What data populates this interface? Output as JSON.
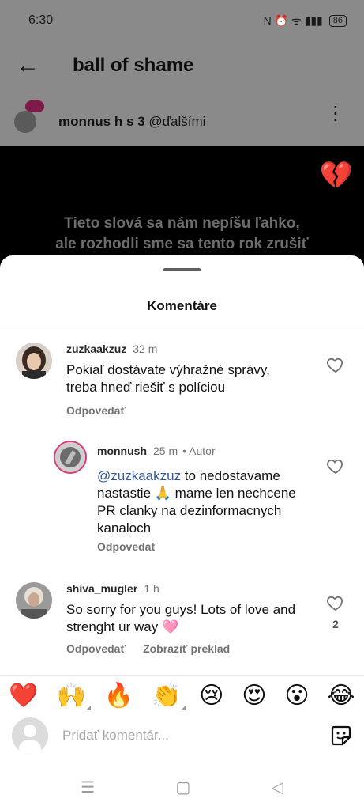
{
  "status_bar": {
    "time": "6:30",
    "icons": "N ⏰ ᯤ ▮▮▮",
    "battery": "86"
  },
  "header": {
    "title": "ball of shame"
  },
  "post": {
    "username": "monnus h s 3",
    "with_others": "@ďalšími",
    "caption_line1": "Tieto slová sa nám nepíšu ľahko,",
    "caption_line2": "ale rozhodli sme sa tento rok zrušiť"
  },
  "sheet": {
    "title": "Komentáre"
  },
  "comments": [
    {
      "username": "zuzkaakzuz",
      "time": "32 m",
      "text_line1": "Pokiaľ dostávate výhražné správy,",
      "text_line2": "treba hneď riešiť s políciou",
      "reply_label": "Odpovedať"
    },
    {
      "username": "monnush",
      "time": "25 m",
      "author_label": "• Autor",
      "mention": "@zuzkaakzuz",
      "text_line1": " to nedostavame",
      "text_line2": "nastastie 🙏 mame len nechcene",
      "text_line3": "PR clanky na dezinformacnych",
      "text_line4": "kanaloch",
      "reply_label": "Odpovedať"
    },
    {
      "username": "shiva_mugler",
      "time": "1 h",
      "text_line1": "So sorry for you guys! Lots of love and",
      "text_line2": "strenght ur way 🩷",
      "reply_label": "Odpovedať",
      "translate_label": "Zobraziť preklad",
      "like_count": "2"
    }
  ],
  "emoji_bar": [
    "❤️",
    "🙌",
    "🔥",
    "👏",
    "😢",
    "😍",
    "😮",
    "😂"
  ],
  "input": {
    "placeholder": "Pridať komentár..."
  },
  "nav": {
    "menu": "☰",
    "home": "▢",
    "back": "◁"
  },
  "colors": {
    "mention": "#385898",
    "sheet_bg": "#ffffff",
    "dim_overlay": "#8a8a8a"
  }
}
